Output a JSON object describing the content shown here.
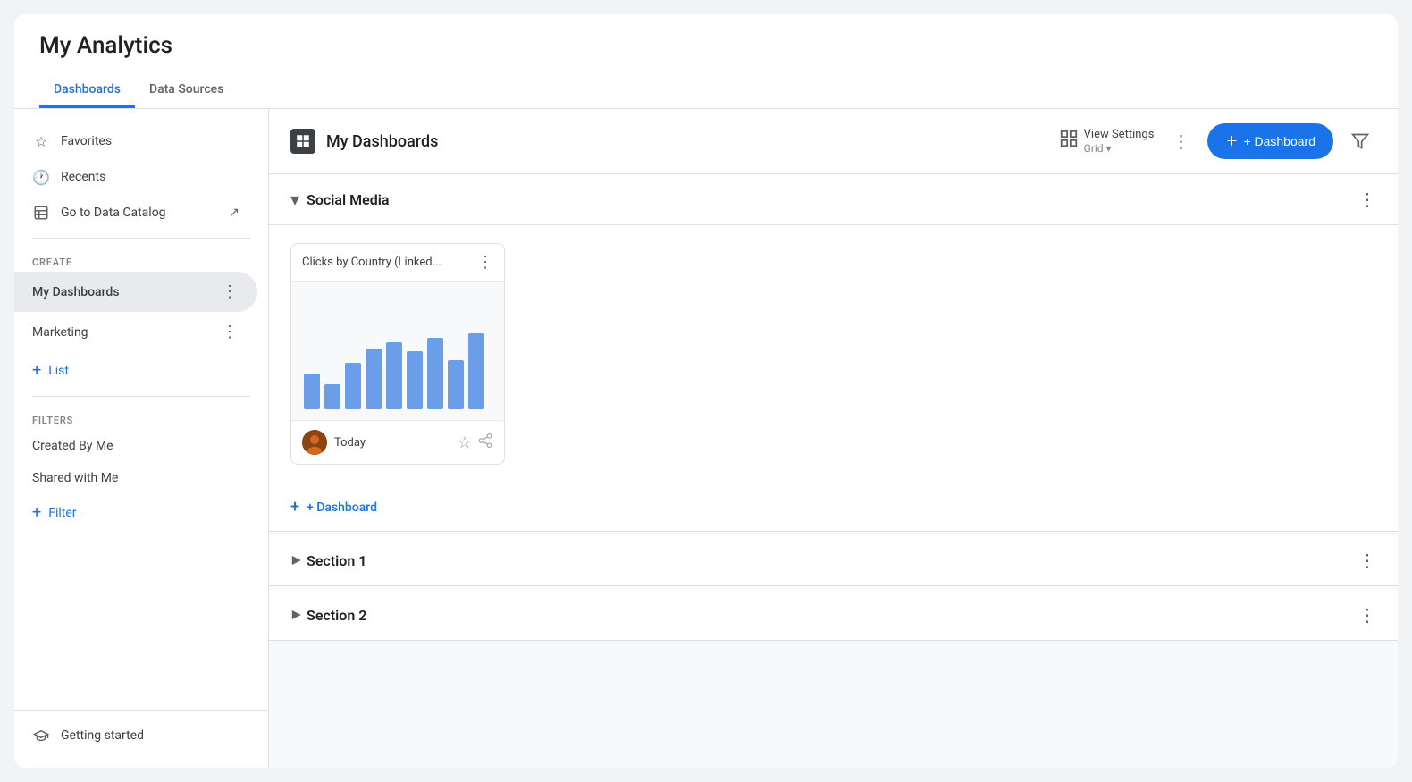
{
  "app": {
    "title": "My Analytics"
  },
  "tabs": [
    {
      "id": "dashboards",
      "label": "Dashboards",
      "active": true
    },
    {
      "id": "data-sources",
      "label": "Data Sources",
      "active": false
    }
  ],
  "sidebar": {
    "nav_items": [
      {
        "id": "favorites",
        "label": "Favorites",
        "icon": "star"
      },
      {
        "id": "recents",
        "label": "Recents",
        "icon": "clock"
      },
      {
        "id": "data-catalog",
        "label": "Go to Data Catalog",
        "icon": "table",
        "external": true
      }
    ],
    "create_section_label": "CREATE",
    "create_items": [
      {
        "id": "my-dashboards",
        "label": "My Dashboards",
        "active": true
      },
      {
        "id": "marketing",
        "label": "Marketing",
        "active": false
      }
    ],
    "add_list_label": "+ List",
    "filters_section_label": "FILTERS",
    "filter_items": [
      {
        "id": "created-by-me",
        "label": "Created By Me"
      },
      {
        "id": "shared-with-me",
        "label": "Shared with Me"
      }
    ],
    "add_filter_label": "+ Filter",
    "getting_started_label": "Getting started"
  },
  "content": {
    "header": {
      "title": "My Dashboards",
      "view_settings_label": "View Settings",
      "view_settings_sub": "Grid",
      "add_dashboard_label": "+ Dashboard"
    },
    "sections": [
      {
        "id": "social-media",
        "title": "Social Media",
        "expanded": true,
        "cards": [
          {
            "id": "card-1",
            "title": "Clicks by Country (Linked...",
            "date": "Today",
            "chart_bars": [
              40,
              28,
              52,
              68,
              75,
              65,
              80,
              55,
              85
            ]
          }
        ],
        "add_label": "+ Dashboard"
      },
      {
        "id": "section-1",
        "title": "Section 1",
        "expanded": false,
        "cards": []
      },
      {
        "id": "section-2",
        "title": "Section 2",
        "expanded": false,
        "cards": []
      }
    ]
  },
  "colors": {
    "accent": "#1a73e8",
    "bar_color": "#6b9de8",
    "active_tab": "#1a73e8"
  }
}
